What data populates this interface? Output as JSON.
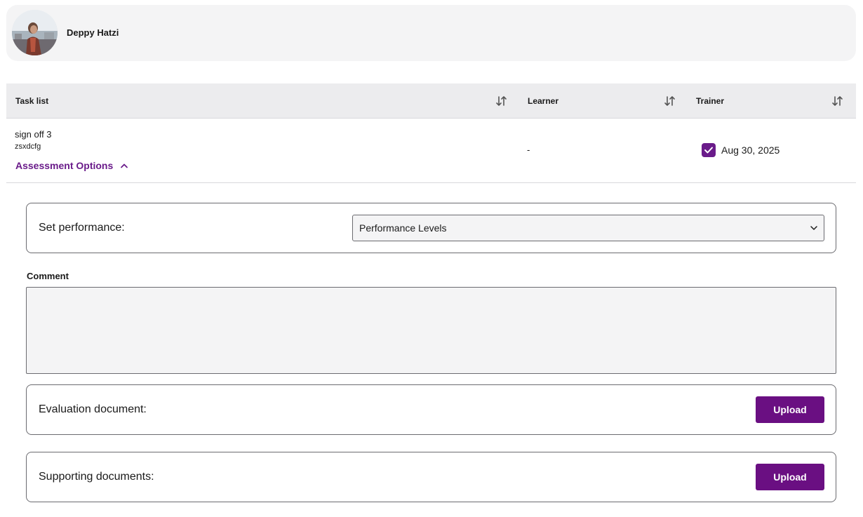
{
  "user": {
    "name": "Deppy Hatzi"
  },
  "table": {
    "headers": {
      "task": "Task list",
      "learner": "Learner",
      "trainer": "Trainer"
    },
    "row": {
      "title": "sign off 3",
      "subtitle": "zsxdcfg",
      "assessment_toggle": "Assessment Options",
      "learner_value": "-",
      "trainer_checked": true,
      "trainer_date": "Aug 30, 2025"
    }
  },
  "assessment": {
    "performance_label": "Set performance:",
    "performance_select": "Performance Levels",
    "comment_label": "Comment",
    "comment_value": "",
    "evaluation_label": "Evaluation document:",
    "supporting_label": "Supporting documents:",
    "upload_label": "Upload"
  },
  "icons": {
    "sort": "sort-arrows-icon",
    "chevron_up": "chevron-up-icon",
    "chevron_down": "chevron-down-icon",
    "check": "check-icon"
  },
  "colors": {
    "accent": "#6a0f82",
    "link": "#6a1b8a"
  }
}
